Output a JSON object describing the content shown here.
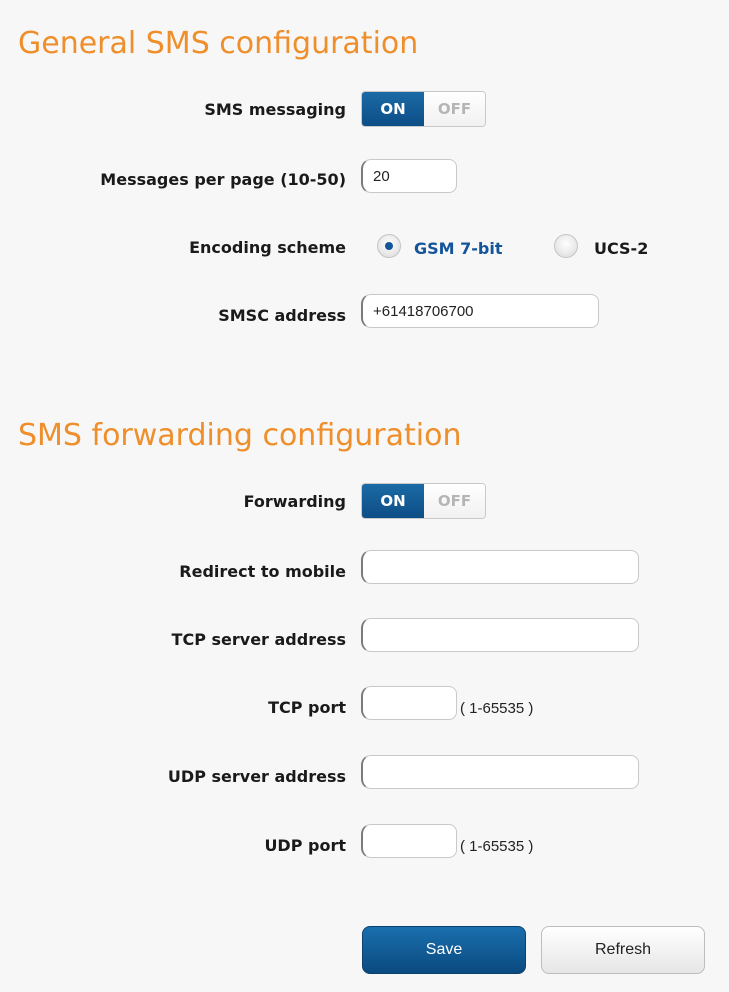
{
  "general": {
    "title": "General SMS configuration",
    "sms_messaging": {
      "label": "SMS messaging",
      "on": "ON",
      "off": "OFF",
      "state": "ON"
    },
    "messages_per_page": {
      "label": "Messages per page (10-50)",
      "value": "20"
    },
    "encoding": {
      "label": "Encoding scheme",
      "options": [
        {
          "label": "GSM 7-bit",
          "selected": true
        },
        {
          "label": "UCS-2",
          "selected": false
        }
      ]
    },
    "smsc": {
      "label": "SMSC address",
      "value": "+61418706700"
    }
  },
  "forwarding": {
    "title": "SMS forwarding configuration",
    "toggle": {
      "label": "Forwarding",
      "on": "ON",
      "off": "OFF",
      "state": "ON"
    },
    "redirect_mobile": {
      "label": "Redirect to mobile",
      "value": ""
    },
    "tcp_server": {
      "label": "TCP server address",
      "value": ""
    },
    "tcp_port": {
      "label": "TCP port",
      "value": "",
      "hint": "( 1-65535 )"
    },
    "udp_server": {
      "label": "UDP server address",
      "value": ""
    },
    "udp_port": {
      "label": "UDP port",
      "value": "",
      "hint": "( 1-65535 )"
    }
  },
  "actions": {
    "save": "Save",
    "refresh": "Refresh"
  },
  "colors": {
    "accent": "#ee8f2c",
    "primary": "#0d4e86",
    "selected_text": "#14549a"
  }
}
